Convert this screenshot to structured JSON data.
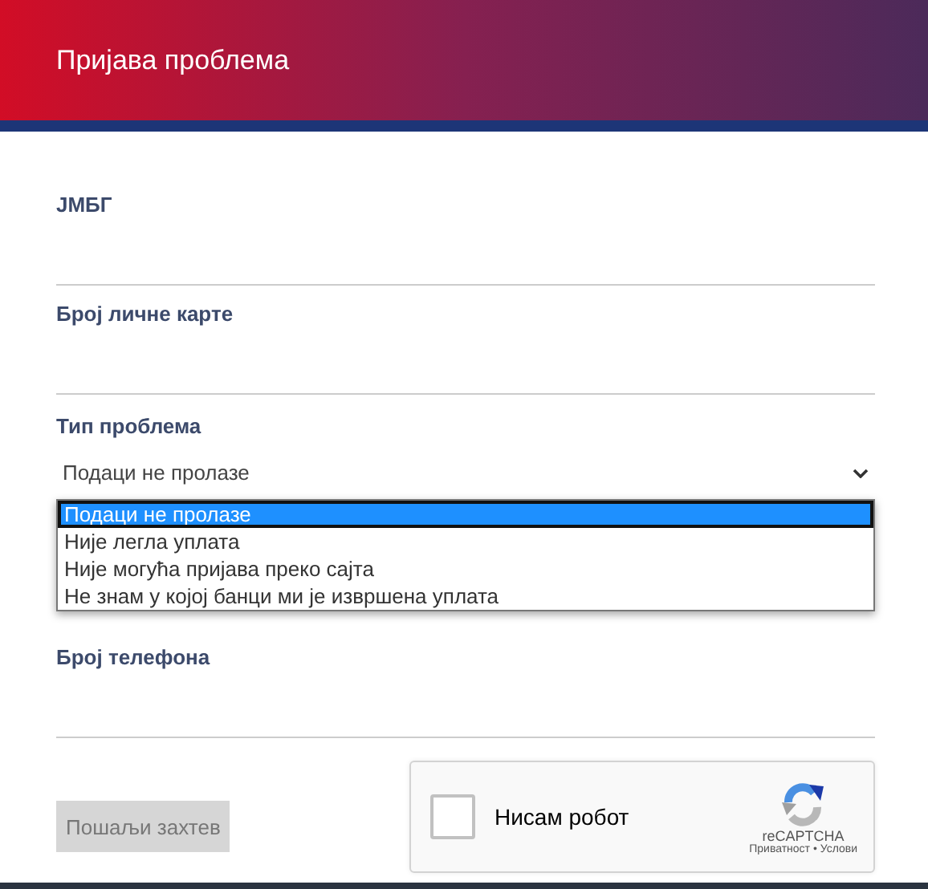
{
  "header": {
    "title": "Пријава проблема"
  },
  "fields": [
    {
      "kind": "text",
      "label": "ЈМБГ"
    },
    {
      "kind": "text",
      "label": "Број личне карте"
    },
    {
      "kind": "select",
      "label": "Тип проблема",
      "value": "Подаци не пролазе",
      "expanded": true,
      "options": [
        {
          "label": "Подаци не пролазе",
          "selected": true
        },
        {
          "label": "Није легла уплата",
          "selected": false
        },
        {
          "label": "Није могућа пријава преко сајта",
          "selected": false
        },
        {
          "label": "Не знам у којој банци ми је извршена уплата",
          "selected": false
        }
      ]
    },
    {
      "kind": "hidden"
    },
    {
      "kind": "text",
      "label": "Број телефона"
    }
  ],
  "submit": {
    "label": "Пошаљи захтев",
    "disabled": true
  },
  "captcha": {
    "label": "Нисам робот",
    "checked": false,
    "brand": "reCAPTCHA",
    "links": "Приватност • Услови"
  }
}
